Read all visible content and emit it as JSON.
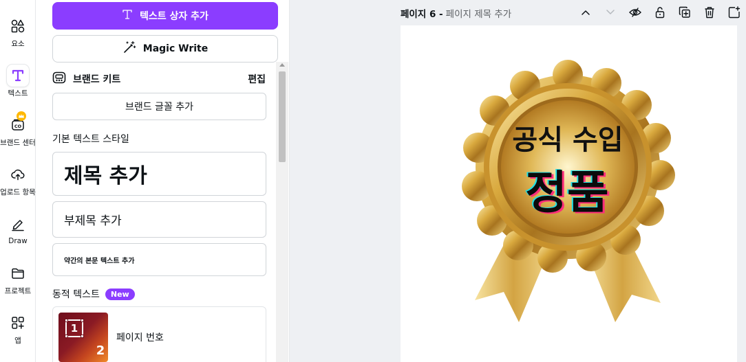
{
  "rail": {
    "items": [
      {
        "label": "요소",
        "icon": "shapes-icon"
      },
      {
        "label": "텍스트",
        "icon": "text-icon"
      },
      {
        "label": "브랜드 센터",
        "icon": "brand-hub-icon"
      },
      {
        "label": "업로드 항목",
        "icon": "cloud-upload-icon"
      },
      {
        "label": "Draw",
        "icon": "pen-icon"
      },
      {
        "label": "프로젝트",
        "icon": "folder-icon"
      },
      {
        "label": "앱",
        "icon": "apps-icon"
      }
    ]
  },
  "panel": {
    "add_textbox_label": "텍스트 상자 추가",
    "magic_write_label": "Magic Write",
    "brand_kit": {
      "title": "브랜드 키트",
      "edit_label": "편집",
      "add_font_label": "브랜드 글꼴 추가"
    },
    "default_styles": {
      "section_label": "기본 텍스트 스타일",
      "heading": "제목 추가",
      "subheading": "부제목 추가",
      "body": "약간의 본문 텍스트 추가"
    },
    "dynamic_text": {
      "section_label": "동적 텍스트",
      "badge": "New",
      "card_label": "페이지 번호",
      "thumb_num1": "1",
      "thumb_num2": "2"
    }
  },
  "page_header": {
    "page_number": "페이지 6 -",
    "title_placeholder": "페이지 제목 추가"
  },
  "page_tools": [
    "chevron-up-icon",
    "chevron-down-icon",
    "hide-icon",
    "lock-icon",
    "duplicate-icon",
    "trash-icon",
    "add-page-icon"
  ],
  "badge_graphic": {
    "line1": "공식 수입",
    "line2": "정품"
  },
  "colors": {
    "accent": "#8b3dff",
    "gold": "#d4a93c",
    "workspace_bg": "#eef0f3"
  }
}
